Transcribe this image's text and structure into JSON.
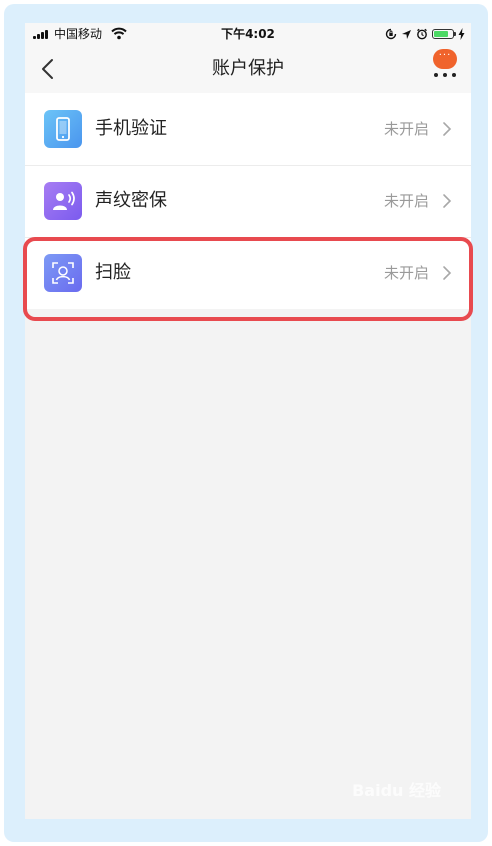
{
  "status_bar": {
    "carrier": "中国移动",
    "time": "下午4:02",
    "battery_level": 0.75,
    "icons": [
      "signal-icon",
      "wifi-icon",
      "rotation-lock-icon",
      "location-icon",
      "alarm-icon",
      "battery-icon",
      "charging-icon"
    ]
  },
  "nav": {
    "title": "账户保护",
    "chat_badge": "···",
    "icons": [
      "back-arrow-icon",
      "more-icon"
    ]
  },
  "items": [
    {
      "label": "手机验证",
      "status": "未开启",
      "icon": "phone-icon",
      "color": "#5aa8f0"
    },
    {
      "label": "声纹密保",
      "status": "未开启",
      "icon": "voiceprint-icon",
      "color": "#8a6cf0"
    },
    {
      "label": "扫脸",
      "status": "未开启",
      "icon": "face-scan-icon",
      "color": "#6c7cf0"
    }
  ],
  "colors": {
    "frame": "#dceffc",
    "highlight": "#e84a4f",
    "badge": "#f0632c"
  },
  "watermark": "Baidu 经验"
}
